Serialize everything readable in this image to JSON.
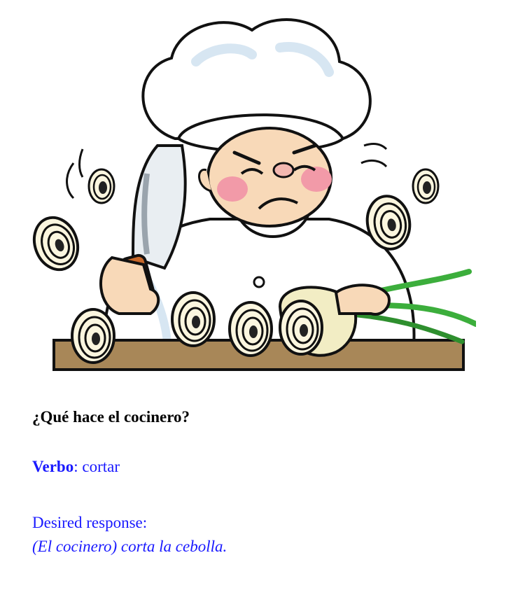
{
  "illustration": {
    "subject": "chef-cutting-onion",
    "colors": {
      "board": "#a88758",
      "skin": "#f8d9b8",
      "blush": "#f29aa8",
      "hat": "#ffffff",
      "shading": "#d7e6f2",
      "handle": "#c8682a",
      "greens": "#3cae3c"
    }
  },
  "question": "¿Qué hace el cocinero?",
  "verb": {
    "label": "Verbo",
    "separator": ": ",
    "value": "cortar"
  },
  "response": {
    "label": "Desired response:",
    "answer": "(El cocinero) corta la cebolla."
  },
  "colors": {
    "accent": "#1a1aff",
    "text": "#000000"
  }
}
